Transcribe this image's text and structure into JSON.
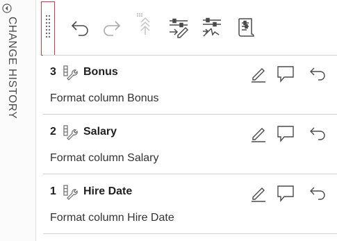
{
  "panel": {
    "title": "CHANGE HISTORY",
    "collapse_icon": "collapse-left-icon"
  },
  "toolbar": {
    "buttons": [
      {
        "name": "undo-button",
        "icon": "undo-arrow-icon"
      },
      {
        "name": "redo-button",
        "icon": "redo-arrow-icon"
      },
      {
        "name": "collapse-steps-button",
        "icon": "grid-up-chevrons-icon"
      },
      {
        "name": "edit-filter-button",
        "icon": "sliders-pen-icon"
      },
      {
        "name": "apply-steps-button",
        "icon": "sliders-arrow-icon"
      },
      {
        "name": "script-button",
        "icon": "script-icon"
      }
    ]
  },
  "history": [
    {
      "number": "3",
      "column": "Bonus",
      "description": "Format column Bonus",
      "kind_icon": "column-format-wrench-icon"
    },
    {
      "number": "2",
      "column": "Salary",
      "description": "Format column Salary",
      "kind_icon": "column-format-wrench-icon"
    },
    {
      "number": "1",
      "column": "Hire Date",
      "description": "Format column Hire Date",
      "kind_icon": "column-format-wrench-icon"
    }
  ],
  "entry_actions": [
    "edit-pencil-icon",
    "comment-icon",
    "revert-arrow-icon"
  ],
  "colors": {
    "accent_highlight": "#d9363e",
    "icon_stroke": "#4a4a4a",
    "separator": "#d2d2d2"
  }
}
